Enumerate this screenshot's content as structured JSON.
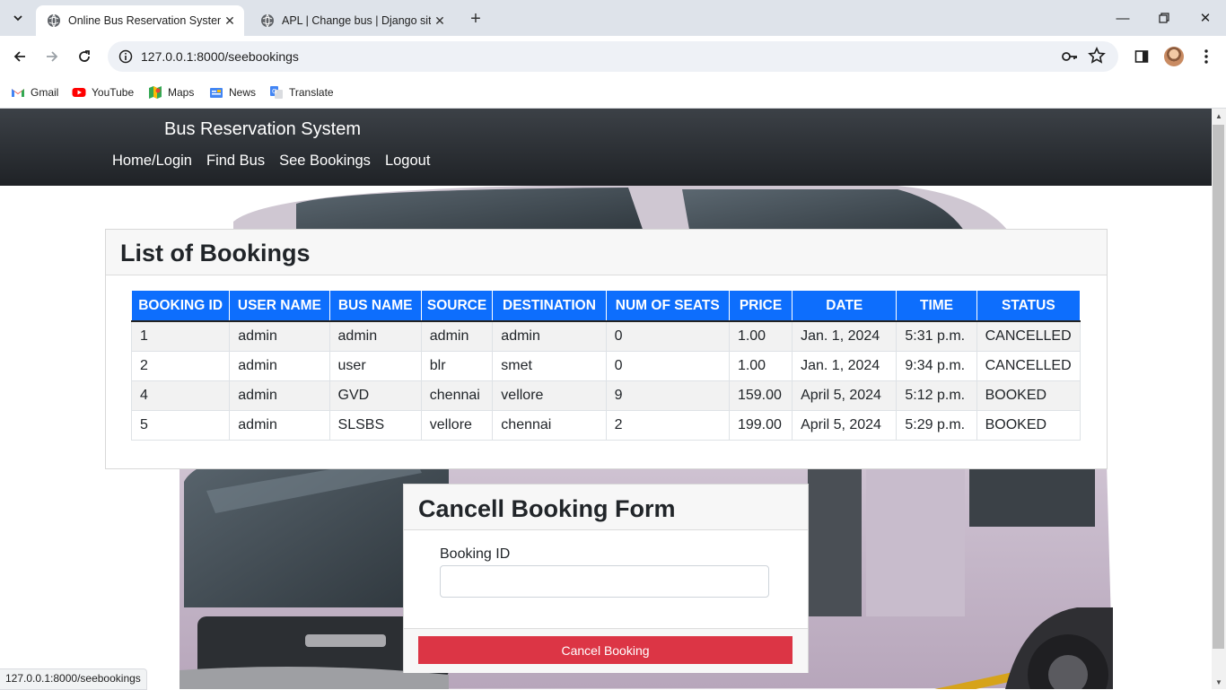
{
  "browser": {
    "tabs": [
      {
        "title": "Online Bus Reservation System",
        "active": true
      },
      {
        "title": "APL | Change bus | Django site",
        "active": false
      }
    ],
    "url": "127.0.0.1:8000/seebookings",
    "status_url": "127.0.0.1:8000/seebookings",
    "bookmarks": [
      {
        "label": "Gmail",
        "icon": "gmail-icon"
      },
      {
        "label": "YouTube",
        "icon": "youtube-icon"
      },
      {
        "label": "Maps",
        "icon": "maps-icon"
      },
      {
        "label": "News",
        "icon": "news-icon"
      },
      {
        "label": "Translate",
        "icon": "translate-icon"
      }
    ]
  },
  "navbar": {
    "brand": "Bus Reservation System",
    "links": [
      "Home/Login",
      "Find Bus",
      "See Bookings",
      "Logout"
    ]
  },
  "bookings": {
    "title": "List of Bookings",
    "columns": [
      "BOOKING ID",
      "USER NAME",
      "BUS NAME",
      "SOURCE",
      "DESTINATION",
      "NUM OF SEATS",
      "PRICE",
      "DATE",
      "TIME",
      "STATUS"
    ],
    "rows": [
      [
        "1",
        "admin",
        "admin",
        "admin",
        "admin",
        "0",
        "1.00",
        "Jan. 1, 2024",
        "5:31 p.m.",
        "CANCELLED"
      ],
      [
        "2",
        "admin",
        "user",
        "blr",
        "smet",
        "0",
        "1.00",
        "Jan. 1, 2024",
        "9:34 p.m.",
        "CANCELLED"
      ],
      [
        "4",
        "admin",
        "GVD",
        "chennai",
        "vellore",
        "9",
        "159.00",
        "April 5, 2024",
        "5:12 p.m.",
        "BOOKED"
      ],
      [
        "5",
        "admin",
        "SLSBS",
        "vellore",
        "chennai",
        "2",
        "199.00",
        "April 5, 2024",
        "5:29 p.m.",
        "BOOKED"
      ]
    ]
  },
  "cancel_form": {
    "title": "Cancell Booking Form",
    "field_label": "Booking ID",
    "field_value": "",
    "button_label": "Cancel Booking"
  },
  "colors": {
    "navbar": "#212529",
    "table_header": "#0d6efd",
    "danger": "#dc3545"
  }
}
